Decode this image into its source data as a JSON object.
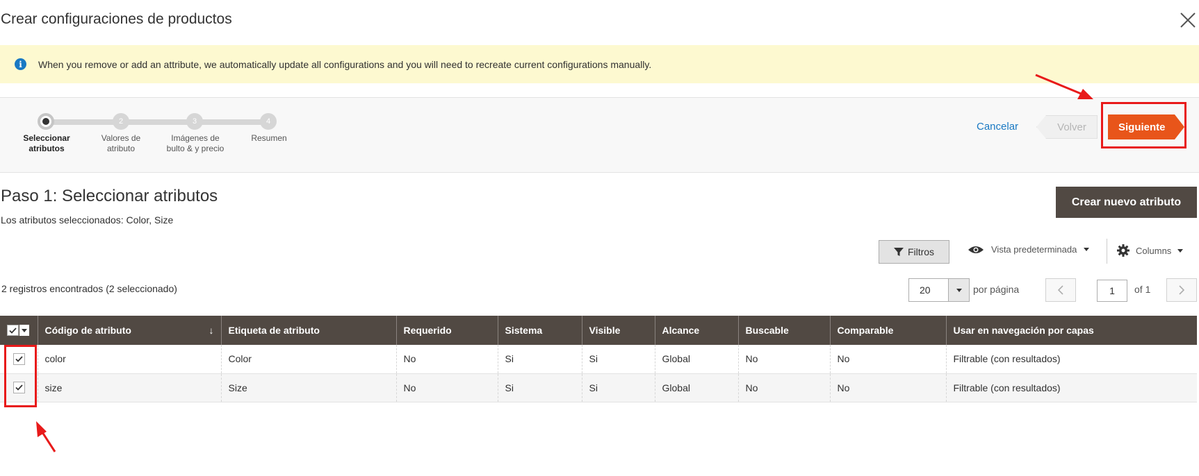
{
  "modal": {
    "title": "Crear configuraciones de productos"
  },
  "notice": {
    "icon": "info-icon",
    "text": "When you remove or add an attribute, we automatically update all configurations and you will need to recreate current configurations manually."
  },
  "wizard": {
    "steps": [
      {
        "number": "",
        "label": "Seleccionar atributos",
        "active": true
      },
      {
        "number": "2",
        "label": "Valores de atributo",
        "active": false
      },
      {
        "number": "3",
        "label": "Imágenes de bulto & y precio",
        "active": false
      },
      {
        "number": "4",
        "label": "Resumen",
        "active": false
      }
    ],
    "cancel_label": "Cancelar",
    "back_label": "Volver",
    "next_label": "Siguiente"
  },
  "step": {
    "title": "Paso 1: Seleccionar atributos",
    "selected_text": "Los atributos seleccionados: Color, Size",
    "create_button": "Crear nuevo atributo"
  },
  "toolbar": {
    "filters_label": "Filtros",
    "view_label": "Vista predeterminada",
    "columns_label": "Columns"
  },
  "pager": {
    "records_text": "2 registros encontrados (2 seleccionado)",
    "per_page": "20",
    "per_page_label": "por página",
    "current_page": "1",
    "of_pages": "of 1"
  },
  "grid": {
    "columns": [
      {
        "label": "Código de atributo",
        "sort": "↓"
      },
      {
        "label": "Etiqueta de atributo"
      },
      {
        "label": "Requerido"
      },
      {
        "label": "Sistema"
      },
      {
        "label": "Visible"
      },
      {
        "label": "Alcance"
      },
      {
        "label": "Buscable"
      },
      {
        "label": "Comparable"
      },
      {
        "label": "Usar en navegación por capas"
      }
    ],
    "rows": [
      {
        "checked": true,
        "code": "color",
        "label": "Color",
        "required": "No",
        "system": "Si",
        "visible": "Si",
        "scope": "Global",
        "searchable": "No",
        "comparable": "No",
        "layered": "Filtrable (con resultados)"
      },
      {
        "checked": true,
        "code": "size",
        "label": "Size",
        "required": "No",
        "system": "Si",
        "visible": "Si",
        "scope": "Global",
        "searchable": "No",
        "comparable": "No",
        "layered": "Filtrable (con resultados)"
      }
    ]
  },
  "colors": {
    "accent": "#e8551a",
    "header_bg": "#514943",
    "link": "#1979c3",
    "notice_bg": "#fdf9d0",
    "annotation": "#e81a1a"
  }
}
